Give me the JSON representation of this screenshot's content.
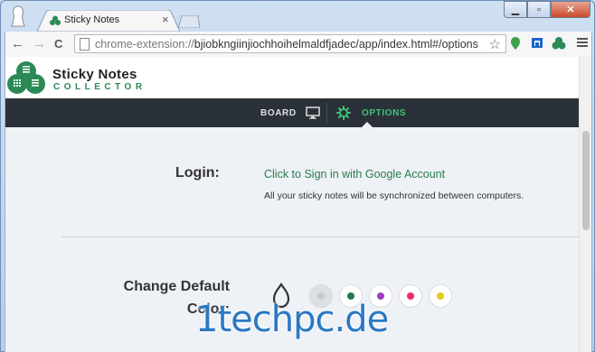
{
  "browser": {
    "tab_title": "Sticky Notes",
    "tab_close": "×",
    "url_prefix": "chrome-extension://",
    "url_rest": "bjiobkngiinjiochhoihelmaldfjadec/app/index.html#/options",
    "window_controls": {
      "minimize": "▁",
      "maximize": "▫",
      "close": "✕"
    },
    "nav": {
      "back": "←",
      "forward": "→",
      "reload": "C"
    },
    "star": "☆",
    "extensions": [
      "map-pin-extension-icon",
      "cast-extension-icon",
      "sticky-notes-extension-icon"
    ]
  },
  "app": {
    "brand_title": "Sticky Notes",
    "brand_subtitle": "COLLECTOR",
    "accent": "#2a8a55",
    "nav": {
      "board_label": "BOARD",
      "options_label": "OPTIONS"
    }
  },
  "options": {
    "login_label": "Login:",
    "signin_link": "Click to Sign in with Google Account",
    "sync_note": "All your sticky notes will be synchronized between computers.",
    "color_label_line1": "Change Default",
    "color_label_line2": "Color:",
    "colors": [
      {
        "name": "grey",
        "hex": "#c9c9c9",
        "selected": true
      },
      {
        "name": "green",
        "hex": "#1e7a4f",
        "selected": false
      },
      {
        "name": "purple",
        "hex": "#a040c0",
        "selected": false
      },
      {
        "name": "pink",
        "hex": "#ee2a6a",
        "selected": false
      },
      {
        "name": "yellow",
        "hex": "#e8cc18",
        "selected": false
      }
    ]
  },
  "watermark": "1techpc.de"
}
